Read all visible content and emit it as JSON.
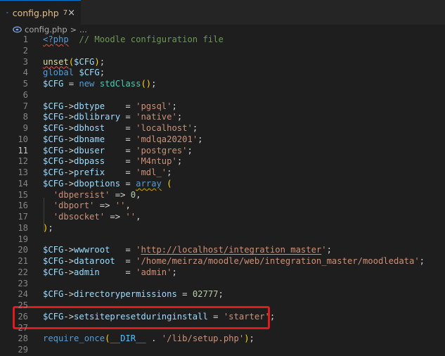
{
  "tab": {
    "filename": "config.php",
    "problems": "7",
    "close": "×"
  },
  "breadcrumb": {
    "file": "config.php",
    "sep": ">",
    "rest": "..."
  },
  "colors": {
    "accent": "#0078d4",
    "highlight_box": "#e01b1b",
    "modified_file": "#e2c08d"
  },
  "icons": {
    "php_file": "php-elephant-icon",
    "close": "close-icon"
  },
  "editor": {
    "active_line": "11",
    "highlighted_line": "26",
    "lines": [
      {
        "num": "1",
        "t": [
          [
            "<?php",
            "t-tag"
          ],
          [
            "  ",
            ""
          ],
          [
            "// Moodle configuration file",
            "t-com"
          ]
        ]
      },
      {
        "num": "2",
        "t": []
      },
      {
        "num": "3",
        "t": [
          [
            "unset",
            "t-fn"
          ],
          [
            "(",
            "t-p1"
          ],
          [
            "$CFG",
            "t-var"
          ],
          [
            ")",
            "t-p1"
          ],
          [
            ";",
            "t-op"
          ]
        ]
      },
      {
        "num": "4",
        "t": [
          [
            "global",
            "t-kw"
          ],
          [
            " ",
            ""
          ],
          [
            "$CFG",
            "t-var"
          ],
          [
            ";",
            "t-op"
          ]
        ]
      },
      {
        "num": "5",
        "t": [
          [
            "$CFG",
            "t-var"
          ],
          [
            " = ",
            "t-op"
          ],
          [
            "new",
            "t-kw"
          ],
          [
            " ",
            ""
          ],
          [
            "stdClass",
            "t-cls"
          ],
          [
            "()",
            "t-p1"
          ],
          [
            ";",
            "t-op"
          ]
        ]
      },
      {
        "num": "6",
        "t": []
      },
      {
        "num": "7",
        "t": [
          [
            "$CFG",
            "t-var"
          ],
          [
            "->",
            "t-op"
          ],
          [
            "dbtype",
            "t-var"
          ],
          [
            "    = ",
            "t-op"
          ],
          [
            "'pgsql'",
            "t-str"
          ],
          [
            ";",
            "t-op"
          ]
        ]
      },
      {
        "num": "8",
        "t": [
          [
            "$CFG",
            "t-var"
          ],
          [
            "->",
            "t-op"
          ],
          [
            "dblibrary",
            "t-var"
          ],
          [
            " = ",
            "t-op"
          ],
          [
            "'native'",
            "t-str"
          ],
          [
            ";",
            "t-op"
          ]
        ]
      },
      {
        "num": "9",
        "t": [
          [
            "$CFG",
            "t-var"
          ],
          [
            "->",
            "t-op"
          ],
          [
            "dbhost",
            "t-var"
          ],
          [
            "    = ",
            "t-op"
          ],
          [
            "'localhost'",
            "t-str"
          ],
          [
            ";",
            "t-op"
          ]
        ]
      },
      {
        "num": "10",
        "t": [
          [
            "$CFG",
            "t-var"
          ],
          [
            "->",
            "t-op"
          ],
          [
            "dbname",
            "t-var"
          ],
          [
            "    = ",
            "t-op"
          ],
          [
            "'mdlqa20201'",
            "t-str"
          ],
          [
            ";",
            "t-op"
          ]
        ]
      },
      {
        "num": "11",
        "t": [
          [
            "$CFG",
            "t-var"
          ],
          [
            "->",
            "t-op"
          ],
          [
            "dbuser",
            "t-var"
          ],
          [
            "    = ",
            "t-op"
          ],
          [
            "'postgres'",
            "t-str"
          ],
          [
            ";",
            "t-op"
          ]
        ]
      },
      {
        "num": "12",
        "t": [
          [
            "$CFG",
            "t-var"
          ],
          [
            "->",
            "t-op"
          ],
          [
            "dbpass",
            "t-var"
          ],
          [
            "    = ",
            "t-op"
          ],
          [
            "'M4ntup'",
            "t-str"
          ],
          [
            ";",
            "t-op"
          ]
        ]
      },
      {
        "num": "13",
        "t": [
          [
            "$CFG",
            "t-var"
          ],
          [
            "->",
            "t-op"
          ],
          [
            "prefix",
            "t-var"
          ],
          [
            "    = ",
            "t-op"
          ],
          [
            "'mdl_'",
            "t-str"
          ],
          [
            ";",
            "t-op"
          ]
        ]
      },
      {
        "num": "14",
        "t": [
          [
            "$CFG",
            "t-var"
          ],
          [
            "->",
            "t-op"
          ],
          [
            "dboptions",
            "t-var"
          ],
          [
            " = ",
            "t-op"
          ],
          [
            "array",
            "t-kw"
          ],
          [
            " ",
            ""
          ],
          [
            "(",
            "t-p1"
          ]
        ]
      },
      {
        "num": "15",
        "t": [
          [
            "  ",
            ""
          ],
          [
            "'dbpersist'",
            "t-str"
          ],
          [
            " => ",
            "t-op"
          ],
          [
            "0",
            "t-num"
          ],
          [
            ",",
            "t-op"
          ]
        ]
      },
      {
        "num": "16",
        "t": [
          [
            "  ",
            ""
          ],
          [
            "'dbport'",
            "t-str"
          ],
          [
            " => ",
            "t-op"
          ],
          [
            "''",
            "t-str"
          ],
          [
            ",",
            "t-op"
          ]
        ]
      },
      {
        "num": "17",
        "t": [
          [
            "  ",
            ""
          ],
          [
            "'dbsocket'",
            "t-str"
          ],
          [
            " => ",
            "t-op"
          ],
          [
            "''",
            "t-str"
          ],
          [
            ",",
            "t-op"
          ]
        ]
      },
      {
        "num": "18",
        "t": [
          [
            ")",
            "t-p1"
          ],
          [
            ";",
            "t-op"
          ]
        ]
      },
      {
        "num": "19",
        "t": []
      },
      {
        "num": "20",
        "t": [
          [
            "$CFG",
            "t-var"
          ],
          [
            "->",
            "t-op"
          ],
          [
            "wwwroot",
            "t-var"
          ],
          [
            "   = ",
            "t-op"
          ],
          [
            "'",
            "t-str"
          ],
          [
            "http://localhost/integration_master",
            "t-str ul"
          ],
          [
            "'",
            "t-str"
          ],
          [
            ";",
            "t-op"
          ]
        ]
      },
      {
        "num": "21",
        "t": [
          [
            "$CFG",
            "t-var"
          ],
          [
            "->",
            "t-op"
          ],
          [
            "dataroot",
            "t-var"
          ],
          [
            "  = ",
            "t-op"
          ],
          [
            "'/home/meirza/moodle/web/integration_master/moodledata'",
            "t-str"
          ],
          [
            ";",
            "t-op"
          ]
        ]
      },
      {
        "num": "22",
        "t": [
          [
            "$CFG",
            "t-var"
          ],
          [
            "->",
            "t-op"
          ],
          [
            "admin",
            "t-var"
          ],
          [
            "     = ",
            "t-op"
          ],
          [
            "'admin'",
            "t-str"
          ],
          [
            ";",
            "t-op"
          ]
        ]
      },
      {
        "num": "23",
        "t": []
      },
      {
        "num": "24",
        "t": [
          [
            "$CFG",
            "t-var"
          ],
          [
            "->",
            "t-op"
          ],
          [
            "directorypermissions",
            "t-var"
          ],
          [
            " = ",
            "t-op"
          ],
          [
            "02777",
            "t-num"
          ],
          [
            ";",
            "t-op"
          ]
        ]
      },
      {
        "num": "25",
        "t": []
      },
      {
        "num": "26",
        "t": [
          [
            "$CFG",
            "t-var"
          ],
          [
            "->",
            "t-op"
          ],
          [
            "setsitepresetduringinstall",
            "t-var"
          ],
          [
            " = ",
            "t-op"
          ],
          [
            "'starter'",
            "t-str"
          ],
          [
            ";",
            "t-op"
          ]
        ]
      },
      {
        "num": "27",
        "t": []
      },
      {
        "num": "28",
        "t": [
          [
            "require_once",
            "t-kw"
          ],
          [
            "(",
            "t-p1"
          ],
          [
            "__DIR__",
            "t-cst"
          ],
          [
            " . ",
            "t-op"
          ],
          [
            "'/lib/setup.php'",
            "t-str"
          ],
          [
            ")",
            "t-p1"
          ],
          [
            ";",
            "t-op"
          ]
        ]
      },
      {
        "num": "29",
        "t": []
      }
    ]
  }
}
